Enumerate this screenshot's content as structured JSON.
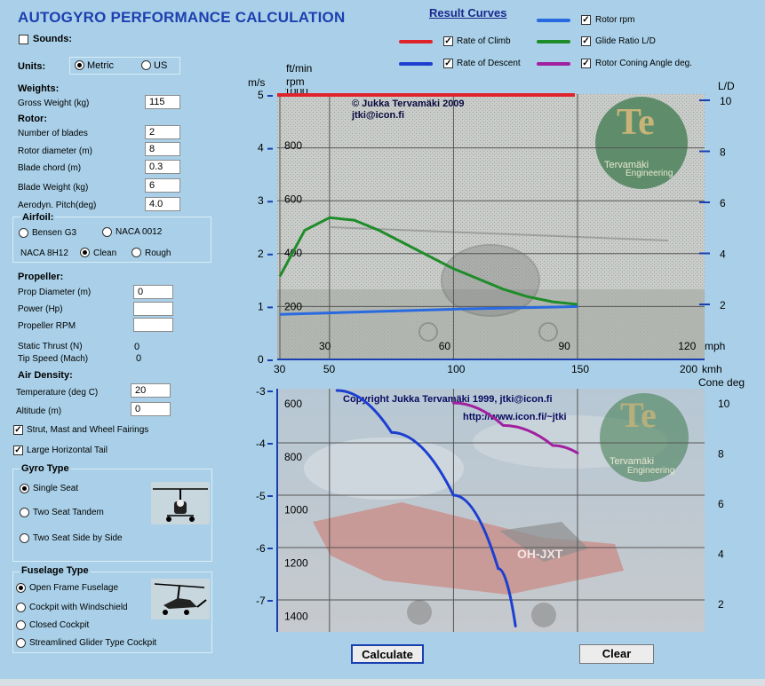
{
  "title": "AUTOGYRO PERFORMANCE CALCULATION",
  "sounds": {
    "label": "Sounds:",
    "checked": false
  },
  "units": {
    "label": "Units:",
    "options": [
      "Metric",
      "US"
    ],
    "selected": "Metric"
  },
  "weights": {
    "heading": "Weights:",
    "gross_weight": {
      "label": "Gross Weight (kg)",
      "value": "115"
    }
  },
  "rotor": {
    "heading": "Rotor:",
    "fields": [
      {
        "label": "Number of blades",
        "value": "2"
      },
      {
        "label": "Rotor diameter (m)",
        "value": "8"
      },
      {
        "label": "Blade chord  (m)",
        "value": "0.3"
      },
      {
        "label": "Blade Weight (kg)",
        "value": "6"
      },
      {
        "label": "Aerodyn. Pitch(deg)",
        "value": "4.0"
      }
    ]
  },
  "airfoil": {
    "heading": "Airfoil:",
    "options": [
      "Bensen G3",
      "NACA 0012"
    ],
    "naca_label": "NACA 8H12",
    "finish_options": [
      "Clean",
      "Rough"
    ],
    "selected_finish": "Clean"
  },
  "propeller": {
    "heading": "Propeller:",
    "fields": [
      {
        "label": "Prop Diameter (m)",
        "value": "0"
      },
      {
        "label": "Power (Hp)",
        "value": ""
      },
      {
        "label": "Propeller RPM",
        "value": ""
      }
    ],
    "static_thrust": {
      "label": "Static Thrust (N)",
      "value": "0"
    },
    "tip_speed": {
      "label": "Tip Speed (Mach)",
      "value": "0"
    }
  },
  "air_density": {
    "heading": "Air Density:",
    "temperature": {
      "label": "Temperature (deg C)",
      "value": "20"
    },
    "altitude": {
      "label": "Altitude  (m)",
      "value": "0"
    }
  },
  "options": [
    {
      "label": "Strut, Mast and Wheel Fairings",
      "checked": true
    },
    {
      "label": "Large Horizontal Tail",
      "checked": true
    }
  ],
  "gyro_type": {
    "heading": "Gyro Type",
    "options": [
      "Single Seat",
      "Two Seat Tandem",
      "Two Seat Side by Side"
    ],
    "selected": "Single Seat"
  },
  "fuselage_type": {
    "heading": "Fuselage Type",
    "options": [
      "Open Frame Fuselage",
      "Cockpit with Windschield",
      "Closed Cockpit",
      "Streamlined Glider Type Cockpit"
    ],
    "selected": "Open Frame Fuselage"
  },
  "legend": {
    "heading": "Result Curves",
    "items": [
      {
        "label": "Rotor rpm",
        "color": "#2a6ae0",
        "checked": true
      },
      {
        "label": "Rate of Climb",
        "color": "#e0232b",
        "checked": true
      },
      {
        "label": "Glide Ratio L/D",
        "color": "#1f8c2a",
        "checked": true
      },
      {
        "label": "Rate of Descent",
        "color": "#1c3fd0",
        "checked": true
      },
      {
        "label": "Rotor Coning Angle deg.",
        "color": "#a020a0",
        "checked": true
      }
    ]
  },
  "top_chart": {
    "unit_ms": "m/s",
    "unit_ftmin": "ft/min",
    "unit_rpm": "rpm",
    "unit_ld": "L/D",
    "unit_mph": "mph",
    "unit_kmh": "kmh",
    "ms_ticks": [
      "5",
      "4",
      "3",
      "2",
      "1",
      "0"
    ],
    "ftmin_ticks": [
      "1000",
      "800",
      "600",
      "400",
      "200"
    ],
    "ld_ticks": [
      "10",
      "8",
      "6",
      "4",
      "2"
    ],
    "mph_ticks": [
      "30",
      "60",
      "90",
      "120"
    ],
    "kmh_ticks": [
      "30",
      "50",
      "100",
      "150",
      "200"
    ],
    "copyright": "© Jukka Tervamäki 2009",
    "email": "jtki@icon.fi",
    "logo_text": "Te",
    "logo_sub1": "Tervamäki",
    "logo_sub2": "Engineering"
  },
  "bottom_chart": {
    "unit_cone": "Cone  deg",
    "ms_ticks": [
      "-3",
      "-4",
      "-5",
      "-6",
      "-7"
    ],
    "ftmin_ticks": [
      "600",
      "800",
      "1000",
      "1200",
      "1400"
    ],
    "cone_ticks": [
      "10",
      "8",
      "6",
      "4",
      "2"
    ],
    "copyright": "Copyright Jukka Tervamäki  1999, jtki@icon.fi",
    "url": "http://www.icon.fi/~jtki",
    "logo_text": "Te",
    "logo_sub1": "Tervamäki",
    "logo_sub2": "Engineering",
    "registration": "OH-JXT"
  },
  "chart_data": [
    {
      "type": "line",
      "x_units": "kmh",
      "x_range": [
        30,
        200
      ],
      "series": [
        {
          "name": "Rate of Climb",
          "color": "#e0232b",
          "axis": "m/s",
          "x": [
            30,
            200
          ],
          "y": [
            5,
            5
          ]
        },
        {
          "name": "Glide Ratio L/D",
          "color": "#1f8c2a",
          "axis": "L/D",
          "x": [
            30,
            40,
            50,
            60,
            70,
            80,
            90,
            100,
            110,
            120,
            130,
            140,
            150
          ],
          "y": [
            3.1,
            4.9,
            5.4,
            5.3,
            4.9,
            4.4,
            3.9,
            3.4,
            3.0,
            2.6,
            2.3,
            2.1,
            2.0
          ]
        },
        {
          "name": "Rotor rpm",
          "color": "#2a6ae0",
          "axis": "m/s",
          "x": [
            30,
            50,
            100,
            150
          ],
          "y": [
            0.85,
            0.88,
            0.95,
            1.0
          ]
        }
      ],
      "y_left_range": [
        0,
        5
      ],
      "y_right_range": [
        0,
        10
      ]
    },
    {
      "type": "line",
      "x_units": "kmh",
      "x_range": [
        30,
        200
      ],
      "series": [
        {
          "name": "Rate of Descent",
          "color": "#1c3fd0",
          "axis": "m/s",
          "x": [
            53,
            75,
            100,
            118,
            125
          ],
          "y": [
            -3.0,
            -3.8,
            -5.0,
            -6.4,
            -7.5
          ]
        },
        {
          "name": "Rotor Coning Angle deg.",
          "color": "#a020a0",
          "axis": "Cone deg",
          "x": [
            100,
            120,
            140,
            150
          ],
          "y": [
            10.0,
            9.1,
            8.3,
            8.0
          ]
        }
      ],
      "y_left_range": [
        -7.5,
        -3
      ],
      "y_right_range": [
        1,
        10.5
      ]
    }
  ],
  "buttons": {
    "calculate": "Calculate",
    "clear": "Clear"
  }
}
